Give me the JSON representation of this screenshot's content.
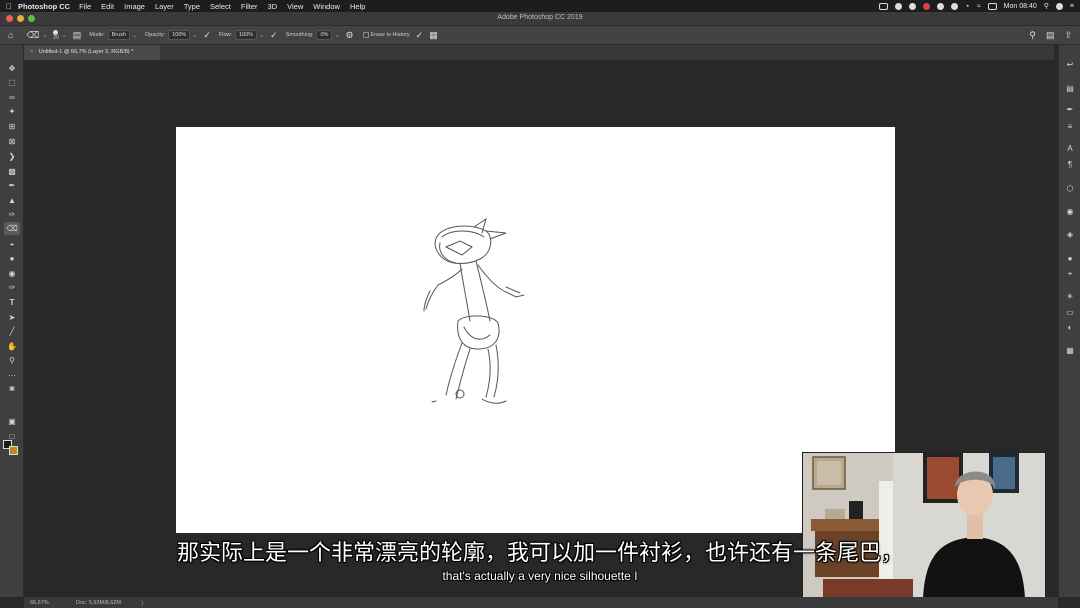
{
  "menubar": {
    "app_name": "Photoshop CC",
    "items": [
      "File",
      "Edit",
      "Image",
      "Layer",
      "Type",
      "Select",
      "Filter",
      "3D",
      "View",
      "Window",
      "Help"
    ],
    "clock": "Mon 08:40"
  },
  "window": {
    "title": "Adobe Photoshop CC 2019"
  },
  "options_bar": {
    "brush_size": "20",
    "mode_label": "Mode:",
    "mode_value": "Brush",
    "opacity_label": "Opacity:",
    "opacity_value": "100%",
    "flow_label": "Flow:",
    "flow_value": "100%",
    "smoothing_label": "Smoothing:",
    "smoothing_value": "0%",
    "erase_history_label": "Erase to History"
  },
  "document": {
    "tab_title": "Untitled-1 @ 66,7% (Layer 2, RGB/8) *"
  },
  "status_bar": {
    "zoom": "66,67%",
    "doc_info": "Doc: 5,93M/8,62M",
    "arrow": "〉"
  },
  "subtitles": {
    "chinese": "那实际上是一个非常漂亮的轮廓，我可以加一件衬衫，也许还有一条尾巴，",
    "english": "that's actually a very nice silhouette I"
  },
  "colors": {
    "foreground": "#1a1a1a",
    "background": "#c9851c",
    "workspace": "#282828",
    "panel": "#3f3f3f"
  },
  "tools": [
    "move-icon",
    "marquee-icon",
    "lasso-icon",
    "magic-wand-icon",
    "crop-icon",
    "frame-icon",
    "eyedropper-icon",
    "healing-icon",
    "brush-icon",
    "stamp-icon",
    "history-brush-icon",
    "eraser-icon",
    "bucket-icon",
    "blur-icon",
    "dodge-icon",
    "pen-icon",
    "type-icon",
    "path-select-icon",
    "line-icon",
    "hand-icon",
    "zoom-icon",
    "more-tools-icon"
  ]
}
